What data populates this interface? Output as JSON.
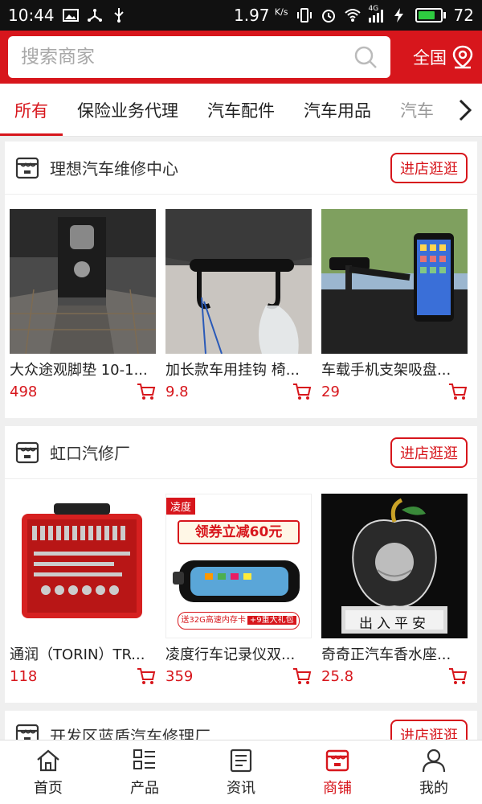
{
  "status_bar": {
    "time": "10:44",
    "net_speed": "1.97",
    "net_unit": "K/s",
    "battery": "72",
    "battery_level": 0.72,
    "network_label": "4G"
  },
  "search": {
    "placeholder": "搜索商家",
    "region_label": "全国"
  },
  "tabs": [
    {
      "label": "所有",
      "active": true
    },
    {
      "label": "保险业务代理"
    },
    {
      "label": "汽车配件"
    },
    {
      "label": "汽车用品"
    },
    {
      "label": "汽车"
    }
  ],
  "shops": [
    {
      "name": "理想汽车维修中心",
      "button": "进店逛逛",
      "products": [
        {
          "name": "大众途观脚垫 10-1...",
          "price": "498",
          "image": "car-floor-mat"
        },
        {
          "name": "加长款车用挂钩 椅...",
          "price": "9.8",
          "image": "car-seat-hook"
        },
        {
          "name": "车载手机支架吸盘...",
          "price": "29",
          "image": "phone-holder"
        }
      ]
    },
    {
      "name": "虹口汽修厂",
      "button": "进店逛逛",
      "products": [
        {
          "name": "通润（TORIN）TR...",
          "price": "118",
          "image": "tool-kit"
        },
        {
          "name": "凌度行车记录仪双...",
          "price": "359",
          "image": "dashcam-mirror",
          "badge": "凌度",
          "promo": "领券立减60元",
          "promo_sub": "送32G高速内存卡",
          "promo_gift": "+9重大礼包"
        },
        {
          "name": "奇奇正汽车香水座...",
          "price": "25.8",
          "image": "crystal-apple",
          "base_text": "出入平安"
        }
      ]
    },
    {
      "name": "开发区蓝盾汽车修理厂",
      "button": "进店逛逛"
    }
  ],
  "bottom_nav": [
    {
      "label": "首页",
      "icon": "home-icon"
    },
    {
      "label": "产品",
      "icon": "grid-list-icon"
    },
    {
      "label": "资讯",
      "icon": "news-icon"
    },
    {
      "label": "商铺",
      "icon": "store-icon",
      "active": true
    },
    {
      "label": "我的",
      "icon": "user-icon"
    }
  ],
  "colors": {
    "brand": "#d7161c",
    "battery": "#2ecc40"
  }
}
